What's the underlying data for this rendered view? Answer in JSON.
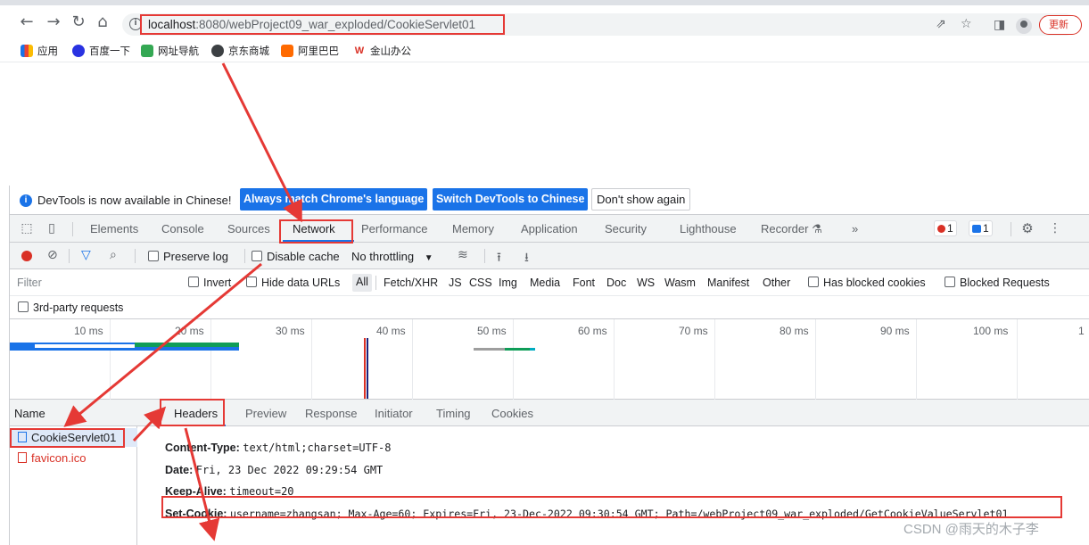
{
  "browser": {
    "url_host": "localhost",
    "url_rest": ":8080/webProject09_war_exploded/CookieServlet01",
    "update_label": "更新",
    "bookmarks": [
      {
        "label": "应用",
        "icon": "apps-grid-icon",
        "color": "#1a73e8"
      },
      {
        "label": "百度一下",
        "icon": "baidu-paw-icon",
        "color": "#2932e1"
      },
      {
        "label": "网址导航",
        "icon": "navigation-icon",
        "color": "#34a853"
      },
      {
        "label": "京东商城",
        "icon": "globe-icon",
        "color": "#3c4043"
      },
      {
        "label": "阿里巴巴",
        "icon": "alibaba-icon",
        "color": "#ff6a00"
      },
      {
        "label": "金山办公",
        "icon": "wps-icon",
        "color": "#d93025"
      }
    ]
  },
  "devtools": {
    "infobar": {
      "text": "DevTools is now available in Chinese!",
      "btn_match": "Always match Chrome's language",
      "btn_switch": "Switch DevTools to Chinese",
      "btn_dismiss": "Don't show again"
    },
    "tabs": [
      "Elements",
      "Console",
      "Sources",
      "Network",
      "Performance",
      "Memory",
      "Application",
      "Security",
      "Lighthouse",
      "Recorder"
    ],
    "more_tabs": "»",
    "error_count": "1",
    "message_count": "1",
    "controls": {
      "preserve_log": "Preserve log",
      "disable_cache": "Disable cache",
      "throttling": "No throttling"
    },
    "filter": {
      "placeholder": "Filter",
      "invert": "Invert",
      "hide_data_urls": "Hide data URLs",
      "types": [
        "All",
        "Fetch/XHR",
        "JS",
        "CSS",
        "Img",
        "Media",
        "Font",
        "Doc",
        "WS",
        "Wasm",
        "Manifest",
        "Other"
      ],
      "has_blocked_cookies": "Has blocked cookies",
      "blocked_requests": "Blocked Requests",
      "third_party": "3rd-party requests"
    },
    "timeline_ticks": [
      "10 ms",
      "20 ms",
      "30 ms",
      "40 ms",
      "50 ms",
      "60 ms",
      "70 ms",
      "80 ms",
      "90 ms",
      "100 ms",
      "1"
    ],
    "name_header": "Name",
    "requests": [
      "CookieServlet01",
      "favicon.ico"
    ],
    "close_glyph": "×",
    "detail_tabs": [
      "Headers",
      "Preview",
      "Response",
      "Initiator",
      "Timing",
      "Cookies"
    ],
    "headers": [
      {
        "key": "Content-Type:",
        "value": "text/html;charset=UTF-8"
      },
      {
        "key": "Date:",
        "value": "Fri, 23 Dec 2022 09:29:54 GMT"
      },
      {
        "key": "Keep-Alive:",
        "value": "timeout=20"
      },
      {
        "key": "Set-Cookie:",
        "value": "username=zhangsan; Max-Age=60; Expires=Fri, 23-Dec-2022 09:30:54 GMT; Path=/webProject09_war_exploded/GetCookieValueServlet01"
      }
    ]
  },
  "watermark": "CSDN @雨天的木子李",
  "colors": {
    "accent": "#1a73e8",
    "annotation": "#e53935",
    "error": "#d93025"
  }
}
